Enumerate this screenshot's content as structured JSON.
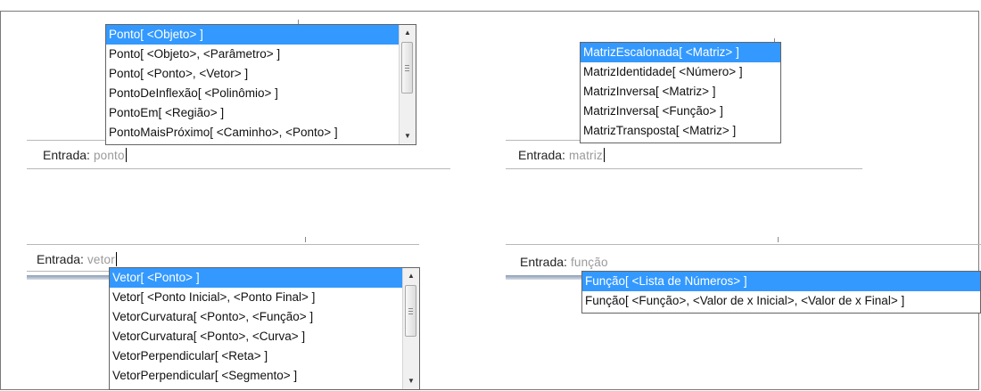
{
  "panels": {
    "ponto": {
      "input_label": "Entrada:",
      "input_value": "ponto",
      "suggestions": [
        "Ponto[ <Objeto> ]",
        "Ponto[ <Objeto>, <Parâmetro> ]",
        "Ponto[ <Ponto>, <Vetor> ]",
        "PontoDeInflexão[ <Polinômio> ]",
        "PontoEm[ <Região> ]",
        "PontoMaisPróximo[ <Caminho>, <Ponto> ]"
      ],
      "selected_index": 0
    },
    "matriz": {
      "input_label": "Entrada:",
      "input_value": "matriz",
      "suggestions": [
        "MatrizEscalonada[ <Matriz> ]",
        "MatrizIdentidade[ <Número> ]",
        "MatrizInversa[ <Matriz> ]",
        "MatrizInversa[ <Função> ]",
        "MatrizTransposta[ <Matriz> ]"
      ],
      "selected_index": 0
    },
    "vetor": {
      "input_label": "Entrada:",
      "input_value": "vetor",
      "suggestions": [
        "Vetor[ <Ponto> ]",
        "Vetor[ <Ponto Inicial>, <Ponto Final> ]",
        "VetorCurvatura[ <Ponto>, <Função> ]",
        "VetorCurvatura[ <Ponto>, <Curva> ]",
        "VetorPerpendicular[ <Reta> ]",
        "VetorPerpendicular[ <Segmento> ]"
      ],
      "selected_index": 0
    },
    "funcao": {
      "input_label": "Entrada:",
      "input_value": "função",
      "suggestions": [
        "Função[ <Lista de Números> ]",
        "Função[ <Função>, <Valor de x Inicial>, <Valor de x Final> ]"
      ],
      "selected_index": 0
    }
  },
  "scroll_icons": {
    "up": "arrow-up-icon",
    "down": "arrow-down-icon"
  },
  "colors": {
    "selection": "#3399ff",
    "input_text": "#9a9a9a"
  }
}
